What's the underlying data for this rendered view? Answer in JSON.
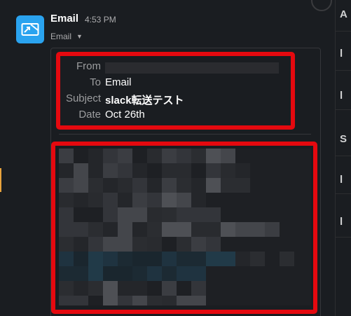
{
  "message": {
    "sender_name": "Email",
    "timestamp": "4:53 PM",
    "subline_label": "Email",
    "avatar_icon": "envelope-share-icon"
  },
  "email": {
    "headers": [
      {
        "label": "From",
        "value": ""
      },
      {
        "label": "To",
        "value": "Email"
      },
      {
        "label": "Subject",
        "value": "slack転送テスト"
      },
      {
        "label": "Date",
        "value": "Oct 26th"
      }
    ]
  },
  "colors": {
    "background": "#1a1d21",
    "avatar": "#2aa3ef",
    "highlight": "#e5090f",
    "accent_left": "#e8a33d"
  }
}
